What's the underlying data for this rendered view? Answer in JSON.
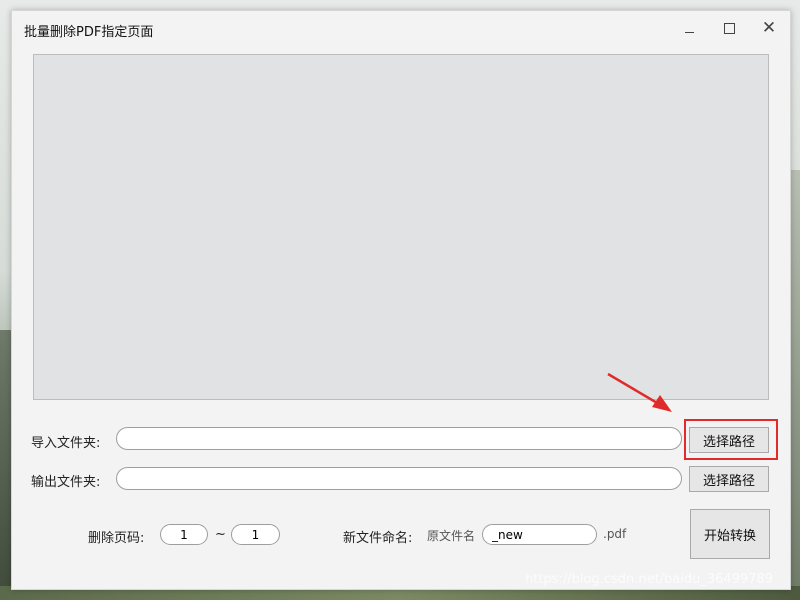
{
  "window": {
    "title": "批量删除PDF指定页面",
    "controls": {
      "minimize": "minimize-icon",
      "maximize": "maximize-icon",
      "close": "close-icon"
    },
    "close_glyph": "✕"
  },
  "import_row": {
    "label": "导入文件夹:",
    "value": "",
    "button_label": "选择路径"
  },
  "export_row": {
    "label": "输出文件夹:",
    "value": "",
    "button_label": "选择路径"
  },
  "page_range": {
    "label": "删除页码:",
    "from": "1",
    "separator": "~",
    "to": "1"
  },
  "rename": {
    "label": "新文件命名:",
    "prefix": "原文件名",
    "suffix_value": "_new",
    "extension": ".pdf"
  },
  "start_button_label": "开始转换",
  "annotation": {
    "highlight_color": "#e02b2b"
  },
  "watermark": "https://blog.csdn.net/baidu_36499789"
}
